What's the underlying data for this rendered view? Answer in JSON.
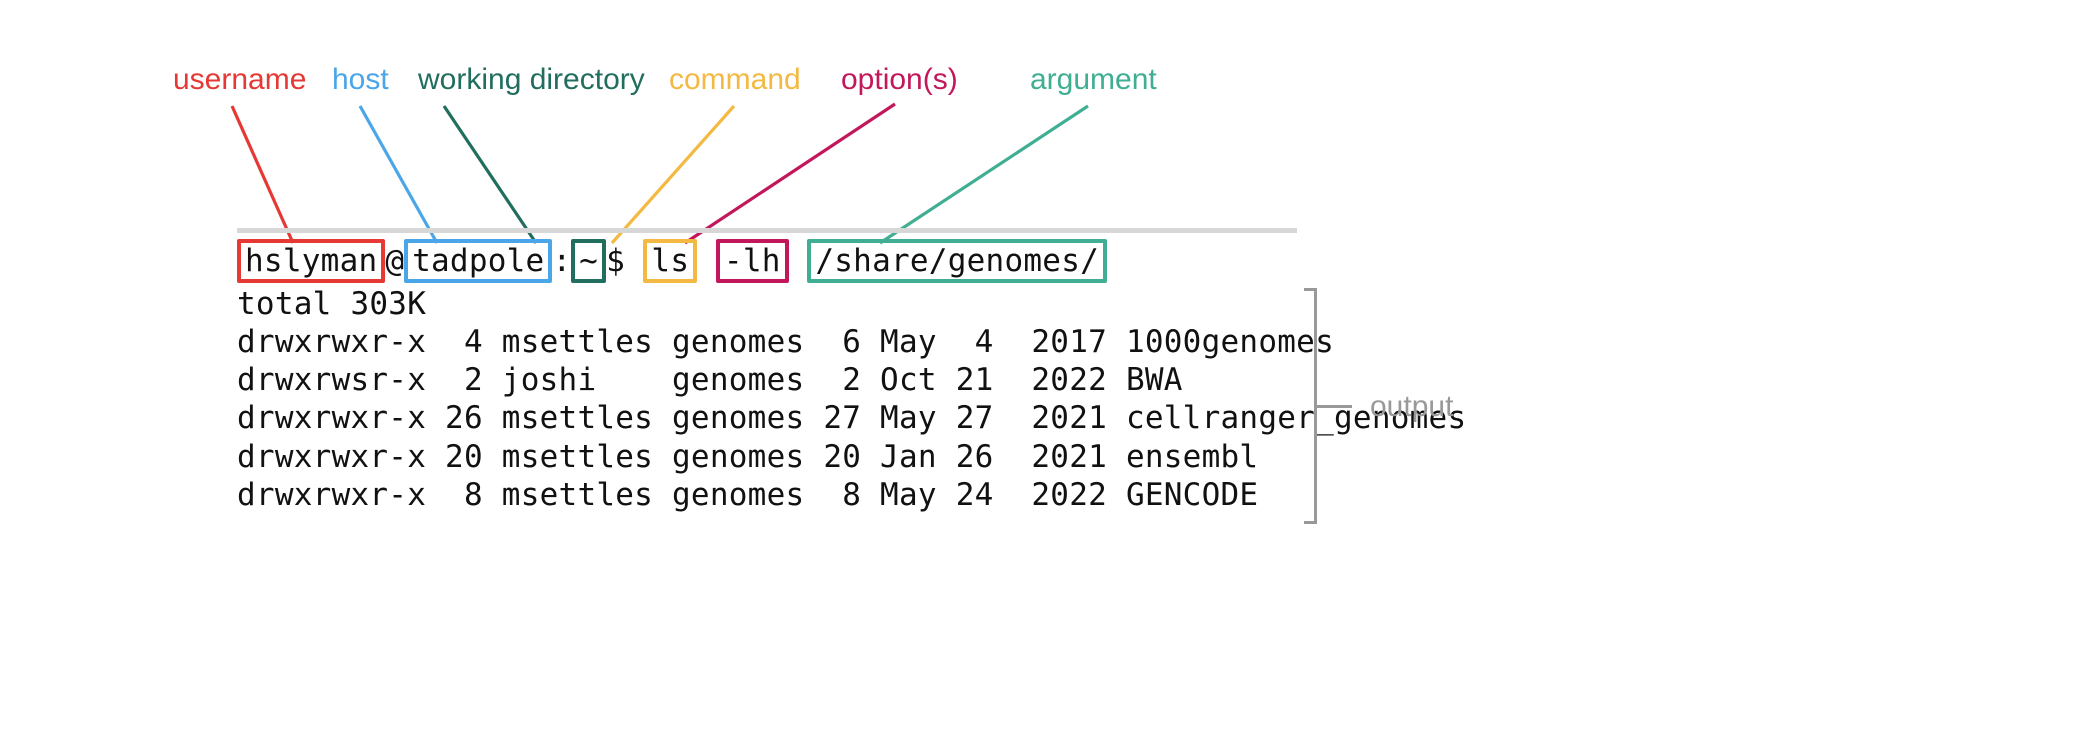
{
  "legend": {
    "username": {
      "label": "username",
      "color": "#E53935"
    },
    "host": {
      "label": "host",
      "color": "#4AA6E8"
    },
    "wd": {
      "label": "working directory",
      "color": "#226E5E"
    },
    "command": {
      "label": "command",
      "color": "#F4B942"
    },
    "options": {
      "label": "option(s)",
      "color": "#C2185B"
    },
    "argument": {
      "label": "argument",
      "color": "#3FAE92"
    }
  },
  "prompt": {
    "username": "hslyman",
    "at": "@",
    "host": "tadpole",
    "colon": ":",
    "wd": "~",
    "dollar": "$ ",
    "command": "ls",
    "space1": " ",
    "options": "-lh",
    "space2": " ",
    "argument": "/share/genomes/"
  },
  "output_lines": [
    "total 303K",
    "drwxrwxr-x  4 msettles genomes  6 May  4  2017 1000genomes",
    "drwxrwsr-x  2 joshi    genomes  2 Oct 21  2022 BWA",
    "drwxrwxr-x 26 msettles genomes 27 May 27  2021 cellranger_genomes",
    "drwxrwxr-x 20 msettles genomes 20 Jan 26  2021 ensembl",
    "drwxrwxr-x  8 msettles genomes  8 May 24  2022 GENCODE"
  ],
  "output_label": "output"
}
